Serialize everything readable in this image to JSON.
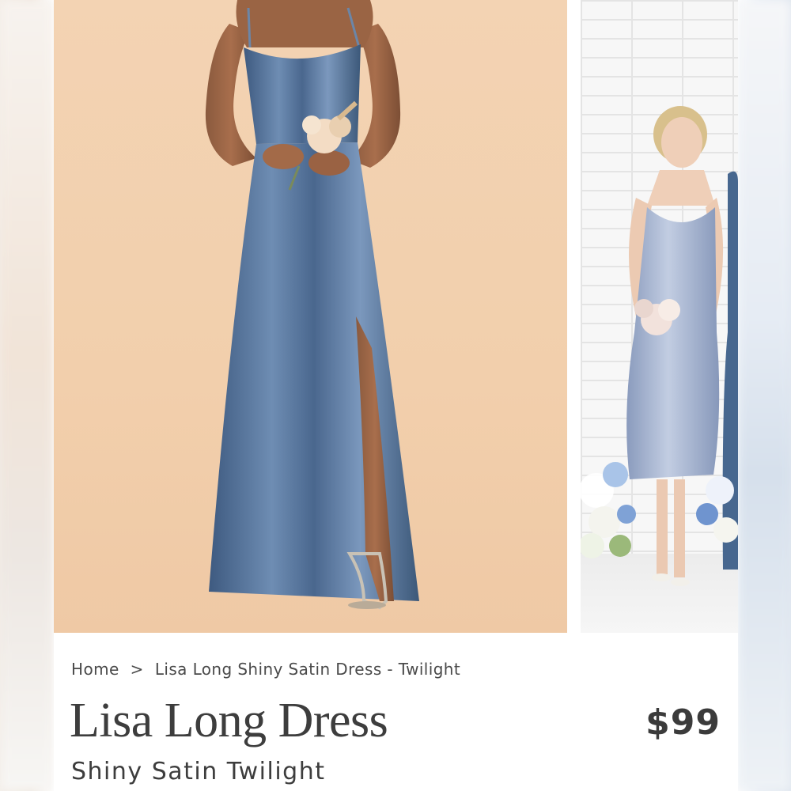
{
  "breadcrumb": {
    "home": "Home",
    "separator": ">",
    "current": "Lisa Long Shiny Satin Dress - Twilight"
  },
  "product": {
    "title": "Lisa Long Dress",
    "price": "$99",
    "subtitle": "Shiny Satin Twilight"
  },
  "colors": {
    "dress_twilight": "#4d6a8f",
    "main_background": "#f2cfac",
    "text": "#3d3d3d"
  },
  "images": {
    "main": "product-photo-model-long-dress",
    "secondary": "lifestyle-photo-bridesmaids"
  }
}
